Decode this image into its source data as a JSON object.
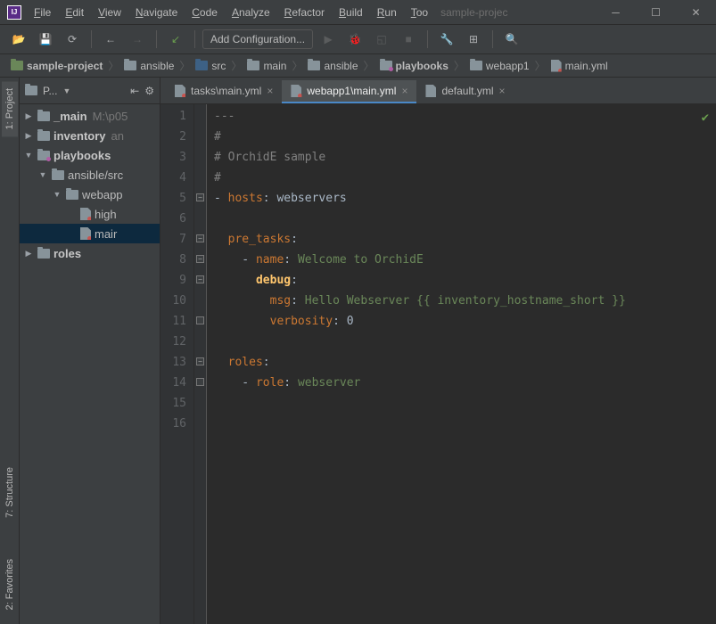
{
  "title": "sample-projec",
  "menu": [
    "File",
    "Edit",
    "View",
    "Navigate",
    "Code",
    "Analyze",
    "Refactor",
    "Build",
    "Run",
    "Too"
  ],
  "toolbar": {
    "config": "Add Configuration..."
  },
  "breadcrumbs": [
    {
      "icon": "module",
      "label": "sample-project",
      "bold": true
    },
    {
      "icon": "folder",
      "label": "ansible"
    },
    {
      "icon": "src",
      "label": "src"
    },
    {
      "icon": "folder",
      "label": "main"
    },
    {
      "icon": "folder",
      "label": "ansible"
    },
    {
      "icon": "pkg",
      "label": "playbooks",
      "bold": true
    },
    {
      "icon": "folder",
      "label": "webapp1"
    },
    {
      "icon": "file-red",
      "label": "main.yml"
    }
  ],
  "leftTabs": [
    "1: Project",
    "7: Structure",
    "2: Favorites"
  ],
  "projectPane": {
    "title": "P..."
  },
  "tree": [
    {
      "indent": 0,
      "arrow": "▶",
      "icon": "folder",
      "bold": true,
      "label": "_main",
      "dim": "M:\\p05"
    },
    {
      "indent": 0,
      "arrow": "▶",
      "icon": "folder",
      "bold": true,
      "label": "inventory",
      "dim": "an"
    },
    {
      "indent": 0,
      "arrow": "▼",
      "icon": "pkg",
      "bold": true,
      "label": "playbooks"
    },
    {
      "indent": 1,
      "arrow": "▼",
      "icon": "folder",
      "label": "ansible/src"
    },
    {
      "indent": 2,
      "arrow": "▼",
      "icon": "folder",
      "label": "webapp"
    },
    {
      "indent": 3,
      "arrow": "",
      "icon": "file-red",
      "label": "high"
    },
    {
      "indent": 3,
      "arrow": "",
      "icon": "file-red",
      "label": "mair",
      "selected": true
    },
    {
      "indent": 0,
      "arrow": "▶",
      "icon": "folder",
      "bold": true,
      "label": "roles"
    }
  ],
  "tabs": [
    {
      "icon": "file-red",
      "label": "tasks\\main.yml",
      "active": false
    },
    {
      "icon": "file-red",
      "label": "webapp1\\main.yml",
      "active": true
    },
    {
      "icon": "file",
      "label": "default.yml",
      "active": false
    }
  ],
  "lines": 16,
  "code": [
    [
      {
        "cls": "tok-comment",
        "t": "---"
      }
    ],
    [
      {
        "cls": "tok-comment",
        "t": "#"
      }
    ],
    [
      {
        "cls": "tok-comment",
        "t": "# OrchidE sample"
      }
    ],
    [
      {
        "cls": "tok-comment",
        "t": "#"
      }
    ],
    [
      {
        "cls": "",
        "t": "- "
      },
      {
        "cls": "tok-key",
        "t": "hosts"
      },
      {
        "cls": "",
        "t": ": webservers"
      }
    ],
    [],
    [
      {
        "cls": "",
        "t": "  "
      },
      {
        "cls": "tok-key",
        "t": "pre_tasks"
      },
      {
        "cls": "",
        "t": ":"
      }
    ],
    [
      {
        "cls": "",
        "t": "    - "
      },
      {
        "cls": "tok-key",
        "t": "name"
      },
      {
        "cls": "",
        "t": ": "
      },
      {
        "cls": "tok-str",
        "t": "Welcome to OrchidE"
      }
    ],
    [
      {
        "cls": "",
        "t": "      "
      },
      {
        "cls": "tok-name2 tok-bold",
        "t": "debug"
      },
      {
        "cls": "",
        "t": ":"
      }
    ],
    [
      {
        "cls": "",
        "t": "        "
      },
      {
        "cls": "tok-key",
        "t": "msg"
      },
      {
        "cls": "",
        "t": ": "
      },
      {
        "cls": "tok-str",
        "t": "Hello Webserver {{ inventory_hostname_short }}"
      }
    ],
    [
      {
        "cls": "",
        "t": "        "
      },
      {
        "cls": "tok-key",
        "t": "verbosity"
      },
      {
        "cls": "",
        "t": ": 0"
      }
    ],
    [],
    [
      {
        "cls": "",
        "t": "  "
      },
      {
        "cls": "tok-key",
        "t": "roles"
      },
      {
        "cls": "",
        "t": ":"
      }
    ],
    [
      {
        "cls": "",
        "t": "    - "
      },
      {
        "cls": "tok-key",
        "t": "role"
      },
      {
        "cls": "",
        "t": ": "
      },
      {
        "cls": "tok-str",
        "t": "webserver"
      }
    ],
    [],
    []
  ],
  "folds": [
    {
      "line": 5,
      "sym": "−"
    },
    {
      "line": 7,
      "sym": "−"
    },
    {
      "line": 8,
      "sym": "−"
    },
    {
      "line": 9,
      "sym": "−"
    },
    {
      "line": 11,
      "sym": ""
    },
    {
      "line": 13,
      "sym": "−"
    },
    {
      "line": 14,
      "sym": ""
    }
  ]
}
